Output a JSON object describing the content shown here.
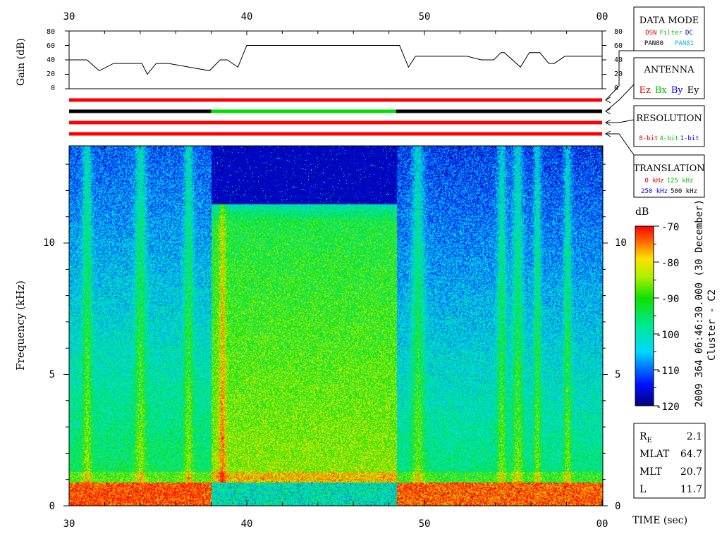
{
  "top_axis": {
    "ticks": [
      "30",
      "40",
      "50",
      "00"
    ]
  },
  "bottom_axis": {
    "ticks": [
      "30",
      "40",
      "50",
      "00"
    ],
    "label": "TIME (sec)"
  },
  "gain_panel": {
    "ylabel": "Gain (dB)",
    "yticks": [
      "80",
      "60",
      "40",
      "20",
      "0"
    ]
  },
  "spectrogram": {
    "ylabel": "Frequency (kHz)",
    "yticks": [
      "10",
      "5",
      "0"
    ]
  },
  "colorbar": {
    "title": "dB",
    "ticks": [
      "-70",
      "-80",
      "-90",
      "-100",
      "-110",
      "-120"
    ],
    "caption_line1": "2009 364 06:46:30.000 (30 December)",
    "caption_line2": "Cluster - C2"
  },
  "legend": {
    "data_mode": {
      "title": "DATA MODE",
      "row1": [
        {
          "text": "DSN",
          "color": "#e00000"
        },
        {
          "text": "Filter",
          "color": "#00c000"
        },
        {
          "text": "DC",
          "color": "#0000e0"
        }
      ],
      "row2": [
        {
          "text": "PAN80",
          "color": "#000000"
        },
        {
          "text": "PAN81",
          "color": "#00b8d8"
        }
      ]
    },
    "antenna": {
      "title": "ANTENNA",
      "items": [
        {
          "text": "Ez",
          "color": "#e00000"
        },
        {
          "text": "Bx",
          "color": "#00c000"
        },
        {
          "text": "By",
          "color": "#0000e0"
        },
        {
          "text": "Ey",
          "color": "#000000"
        }
      ]
    },
    "resolution": {
      "title": "RESOLUTION",
      "items": [
        {
          "text": "8-bit",
          "color": "#e00000"
        },
        {
          "text": "4-bit",
          "color": "#00c000"
        },
        {
          "text": "1-bit",
          "color": "#0000e0"
        }
      ]
    },
    "translation": {
      "title": "TRANSLATION",
      "row1": [
        {
          "text": "0 kHz",
          "color": "#e00000"
        },
        {
          "text": "125 kHz",
          "color": "#00c000"
        }
      ],
      "row2": [
        {
          "text": "250 kHz",
          "color": "#0000e0"
        },
        {
          "text": "500 kHz",
          "color": "#000000"
        }
      ]
    }
  },
  "position_info": {
    "rows": [
      {
        "label": "R",
        "sub": "E",
        "value": "2.1"
      },
      {
        "label": "MLAT",
        "sub": "",
        "value": "64.7"
      },
      {
        "label": "MLT",
        "sub": "",
        "value": "20.7"
      },
      {
        "label": "L",
        "sub": "",
        "value": "11.7"
      }
    ]
  },
  "chart_data": {
    "type": "heatmap",
    "xlabel": "TIME (sec)",
    "ylabel": "Frequency (kHz)",
    "xlim": [
      30,
      60
    ],
    "ylim": [
      0,
      13.7
    ],
    "gain_series": {
      "ylabel": "Gain (dB)",
      "ylim": [
        0,
        80
      ],
      "x": [
        30,
        31,
        31.7,
        32.5,
        34.1,
        34.4,
        34.9,
        35.6,
        37.9,
        38.5,
        38.9,
        39.5,
        40.0,
        41.0,
        48.6,
        49.1,
        49.5,
        50.5,
        52.4,
        53.2,
        53.9,
        54.3,
        54.5,
        55.4,
        55.9,
        56.5,
        57.0,
        57.3,
        57.9,
        60
      ],
      "y": [
        40,
        40,
        25,
        35,
        35,
        20,
        35,
        35,
        25,
        40,
        40,
        30,
        60,
        60,
        60,
        30,
        45,
        45,
        45,
        40,
        40,
        50,
        50,
        30,
        50,
        50,
        35,
        35,
        45,
        45
      ]
    },
    "status_bars": [
      {
        "name": "DATA MODE",
        "segments": [
          {
            "x0": 30,
            "x1": 60,
            "color": "#ff0000"
          }
        ]
      },
      {
        "name": "ANTENNA",
        "segments": [
          {
            "x0": 30,
            "x1": 38,
            "color": "#000000"
          },
          {
            "x0": 38,
            "x1": 48.4,
            "color": "#00e000"
          },
          {
            "x0": 48.4,
            "x1": 60,
            "color": "#000000"
          }
        ]
      },
      {
        "name": "RESOLUTION",
        "segments": [
          {
            "x0": 30,
            "x1": 60,
            "color": "#ff0000"
          }
        ]
      },
      {
        "name": "TRANSLATION",
        "segments": [
          {
            "x0": 30,
            "x1": 60,
            "color": "#ff0000"
          }
        ]
      }
    ],
    "colorbar_range_db": [
      -120,
      -70
    ],
    "regions": [
      {
        "x0": 30,
        "x1": 38,
        "cutoff_khz": 13.7,
        "base_db": -101,
        "low_band_db": -72
      },
      {
        "x0": 38,
        "x1": 48.4,
        "cutoff_khz": 11.5,
        "base_db": -92,
        "low_band_db": -100
      },
      {
        "x0": 48.4,
        "x1": 60,
        "cutoff_khz": 13.7,
        "base_db": -103,
        "low_band_db": -73
      }
    ]
  }
}
